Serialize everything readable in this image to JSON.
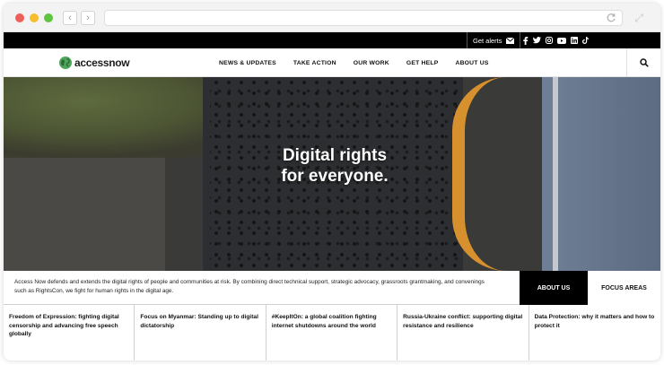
{
  "topbar": {
    "alerts_label": "Get alerts",
    "socials": [
      "f",
      "t",
      "ig",
      "yt",
      "in",
      "tk"
    ]
  },
  "nav": {
    "logo_text": "accessnow",
    "items": [
      "NEWS & UPDATES",
      "TAKE ACTION",
      "OUR WORK",
      "GET HELP",
      "ABOUT US"
    ]
  },
  "hero": {
    "line1": "Digital rights",
    "line2": "for everyone."
  },
  "intro": {
    "text": "Access Now defends and extends the digital rights of people and communities at risk. By combining direct technical support, strategic advocacy, grassroots grantmaking, and convenings such as RightsCon, we fight for human rights in the digital age.",
    "tab_active": "ABOUT US",
    "tab_other": "FOCUS AREAS"
  },
  "cards": [
    "Freedom of Expression: fighting digital censorship and advancing free speech globally",
    "Focus on Myanmar: Standing up to digital dictatorship",
    "#KeepItOn: a global coalition fighting internet shutdowns around the world",
    "Russia-Ukraine conflict: supporting digital resistance and resilience",
    "Data Protection: why it matters and how to protect it"
  ],
  "colors": {
    "brand_green": "#4ea65a",
    "topbar_bg": "#000000",
    "active_tab_bg": "#000000"
  }
}
